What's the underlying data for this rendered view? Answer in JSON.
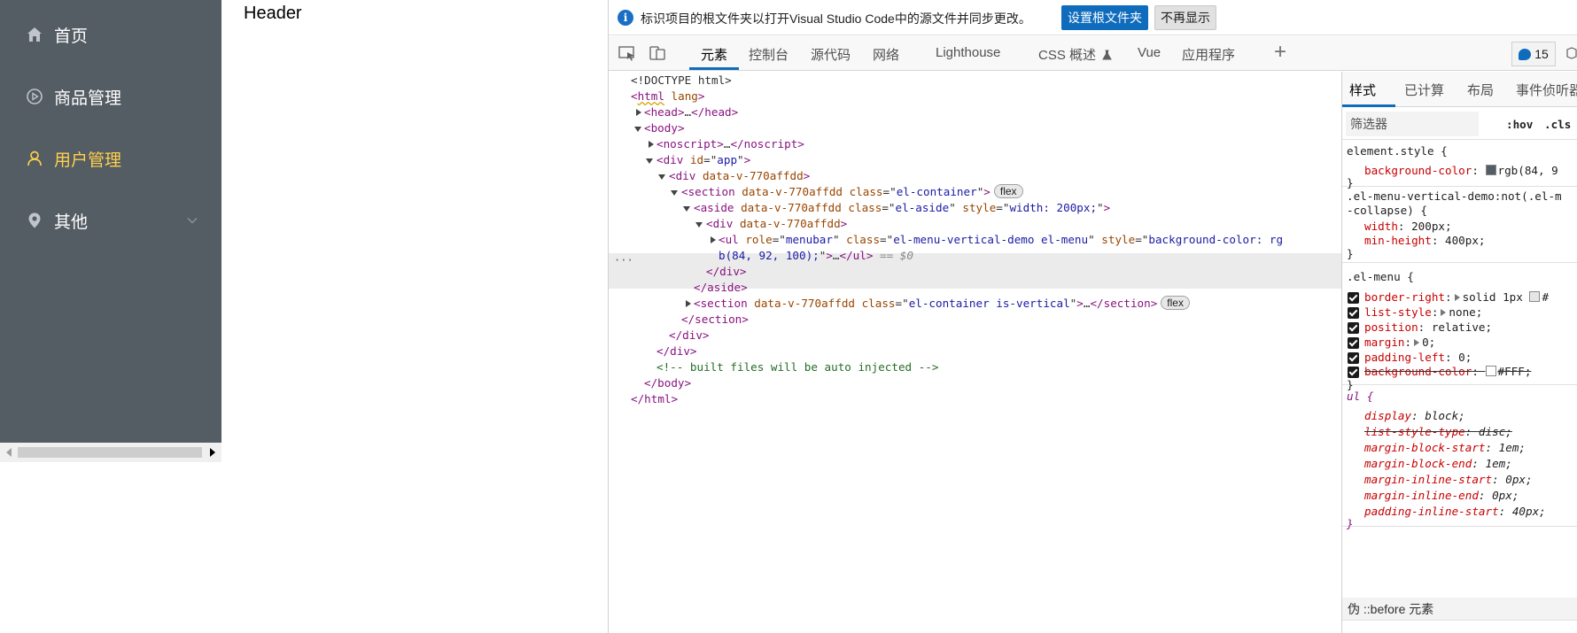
{
  "sidebar": {
    "bg_color": "#545c64",
    "active_color": "#ffd04b",
    "items": [
      {
        "label": "首页",
        "icon": "home-icon"
      },
      {
        "label": "商品管理",
        "icon": "play-circle-icon"
      },
      {
        "label": "用户管理",
        "icon": "user-icon",
        "active": true
      },
      {
        "label": "其他",
        "icon": "location-pin-icon",
        "has_submenu": true
      }
    ]
  },
  "page": {
    "header": "Header"
  },
  "devtools": {
    "infobar": {
      "message": "标识项目的根文件夹以打开Visual Studio Code中的源文件并同步更改。",
      "primary_button": "设置根文件夹",
      "secondary_button": "不再显示"
    },
    "tabs": [
      {
        "label": "元素",
        "active": true
      },
      {
        "label": "控制台"
      },
      {
        "label": "源代码"
      },
      {
        "label": "网络"
      },
      {
        "label": "Lighthouse"
      },
      {
        "label": "CSS 概述"
      },
      {
        "label": "Vue"
      },
      {
        "label": "应用程序"
      }
    ],
    "add_tab_label": "+",
    "issues_count": "15",
    "accent_color": "#0f6cbd",
    "dom": {
      "doctype": "<!DOCTYPE html>",
      "html_open": "html",
      "lang_attr": "lang",
      "head": "head",
      "body": "body",
      "noscript": "noscript",
      "app_id": "app",
      "data_v": "data-v-770affdd",
      "el_container": "el-container",
      "el_aside": "el-aside",
      "aside_style": "width: 200px;",
      "ul_role": "menubar",
      "ul_class": "el-menu-vertical-demo el-menu",
      "ul_style_a": "background-color: rg",
      "ul_style_b": "b(84, 92, 100);",
      "dollar_zero": "== $0",
      "section_vertical_class": "el-container is-vertical",
      "flex_badge": "flex",
      "comment": "<!-- built files will be auto injected -->",
      "ellipsis": "…",
      "selected_marker": "···"
    },
    "styles": {
      "tabs": [
        {
          "label": "样式",
          "active": true
        },
        {
          "label": "已计算"
        },
        {
          "label": "布局"
        },
        {
          "label": "事件侦听器"
        }
      ],
      "filter_placeholder": "筛选器",
      "hov": ":hov",
      "cls": ".cls",
      "element_style_selector": "element.style {",
      "element_style_prop": "background-color",
      "element_style_value": "rgb(84, 9",
      "element_style_swatch": "#545c64",
      "rule2_selector_a": ".el-menu-vertical-demo:not(.el-m",
      "rule2_selector_b": "-collapse) {",
      "rule2_props": [
        {
          "name": "width",
          "value": "200px;"
        },
        {
          "name": "min-height",
          "value": "400px;"
        }
      ],
      "rule3_selector": ".el-menu {",
      "rule3_props": [
        {
          "name": "border-right",
          "value": "solid 1px",
          "extra": "#"
        },
        {
          "name": "list-style",
          "value": "none;"
        },
        {
          "name": "position",
          "value": "relative;"
        },
        {
          "name": "margin",
          "value": "0;"
        },
        {
          "name": "padding-left",
          "value": "0;"
        },
        {
          "name": "background-color",
          "value": "#FFF;",
          "struck": true
        }
      ],
      "rule4_selector": "ul {",
      "rule4_props": [
        {
          "name": "display",
          "value": "block;"
        },
        {
          "name": "list-style-type",
          "value": "disc;",
          "struck": true
        },
        {
          "name": "margin-block-start",
          "value": "1em;"
        },
        {
          "name": "margin-block-end",
          "value": "1em;"
        },
        {
          "name": "margin-inline-start",
          "value": "0px;"
        },
        {
          "name": "margin-inline-end",
          "value": "0px;"
        },
        {
          "name": "padding-inline-start",
          "value": "40px;"
        }
      ],
      "close_brace": "}",
      "pseudo_header": "伪 ::before 元素"
    }
  }
}
